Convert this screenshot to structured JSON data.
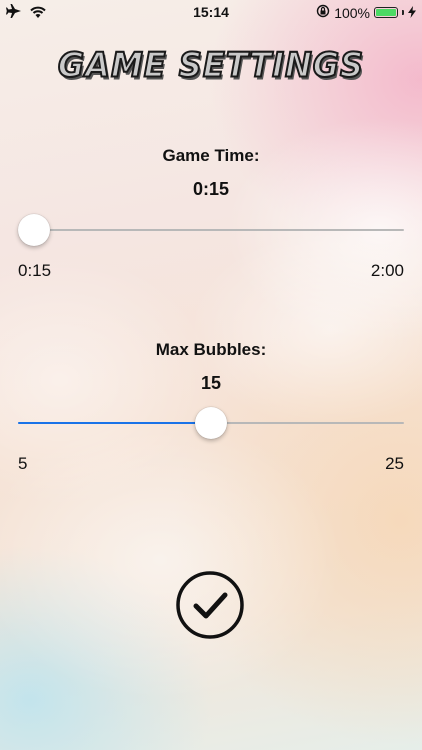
{
  "status_bar": {
    "time": "15:14",
    "battery_text": "100%",
    "icons": [
      "airplane-icon",
      "wifi-icon",
      "orientation-lock-icon",
      "battery-icon",
      "charging-icon"
    ]
  },
  "title": "GAME SETTINGS",
  "game_time": {
    "label": "Game Time:",
    "value": "0:15",
    "min_label": "0:15",
    "max_label": "2:00",
    "level": 0
  },
  "max_bubbles": {
    "label": "Max Bubbles:",
    "value": "15",
    "min_label": "5",
    "max_label": "25",
    "level": 0.5
  },
  "done": {
    "icon": "checkmark-circle-icon"
  },
  "colors": {
    "slider_active": "#1a73e8",
    "slider_track": "#b8b8b8",
    "battery_green": "#4cd964"
  }
}
